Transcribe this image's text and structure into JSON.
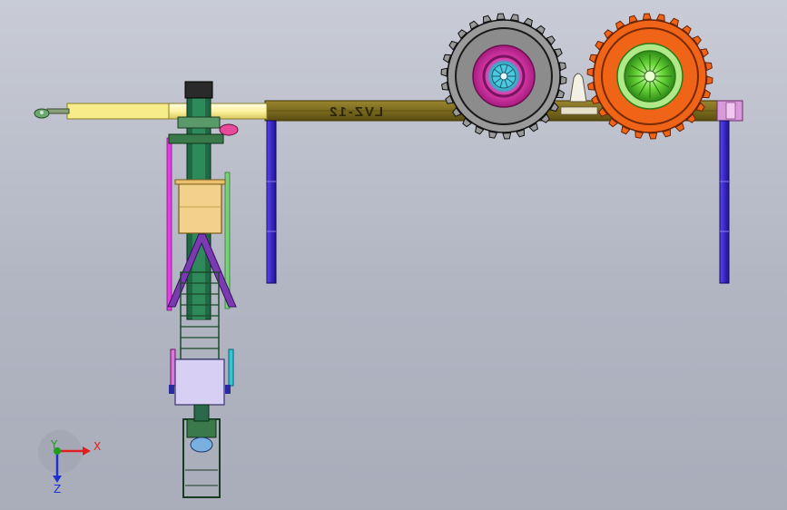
{
  "viewport": {
    "background_top": "#c9ccd6",
    "background_bottom": "#a9adba"
  },
  "model": {
    "frame_marking": "LVZ-12",
    "colors": {
      "main_beam": "#7a6a1e",
      "drawbar": "#fff3a0",
      "left_wheel_tire": "#2f2f2f",
      "left_wheel_rim": "#e040b0",
      "left_wheel_hub": "#30b0c8",
      "right_wheel_tire": "#f06418",
      "right_wheel_rim": "#6ad838",
      "support_leg": "#3a28c8",
      "boom_green": "#1f6a44",
      "boom_box": "#f2d28a",
      "brace_purple": "#7a3ab0",
      "carriage_box": "#d8d0f4",
      "end_cap": "#d89ad8"
    }
  },
  "triad": {
    "x_label": "X",
    "y_label": "Y",
    "z_label": "Z",
    "x_color": "#e02020",
    "y_color": "#1aa01a",
    "z_color": "#2030d0"
  }
}
